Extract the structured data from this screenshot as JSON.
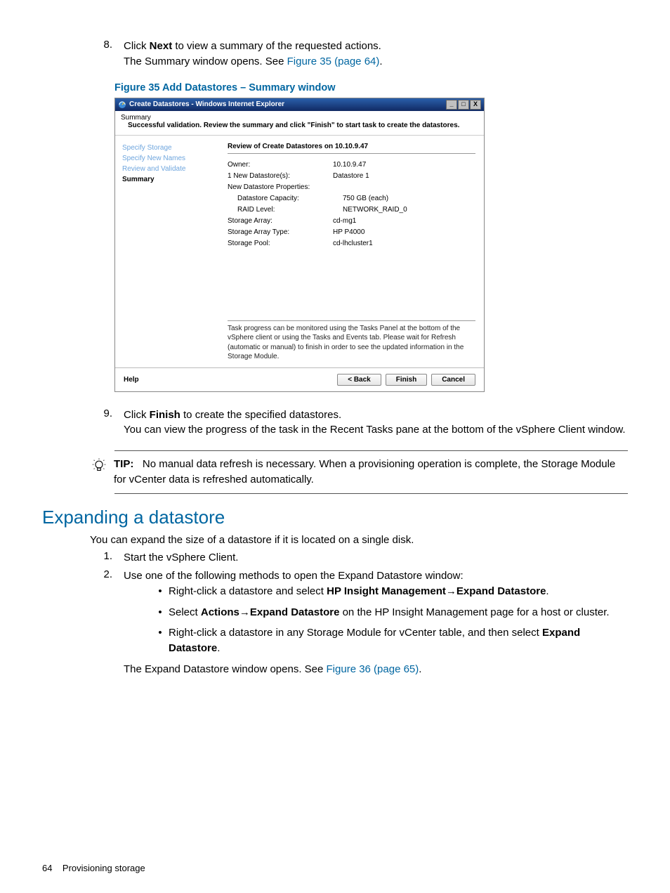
{
  "step8": {
    "num": "8.",
    "line1a": "Click ",
    "line1b": "Next",
    "line1c": " to view a summary of the requested actions.",
    "line2a": "The Summary window opens. See ",
    "line2link": "Figure 35 (page 64)",
    "line2b": "."
  },
  "figcap": "Figure 35 Add Datastores – Summary window",
  "dialog": {
    "title": "Create Datastores - Windows Internet Explorer",
    "wb_min": "_",
    "wb_max": "□",
    "wb_close": "X",
    "head_t1": "Summary",
    "head_t2": "Successful validation. Review the summary and click \"Finish\" to start task to create the datastores.",
    "nav": {
      "n1": "Specify Storage",
      "n2": "Specify New Names",
      "n3": "Review and Validate",
      "n4": "Summary"
    },
    "review_hdr": "Review of Create Datastores on 10.10.9.47",
    "rows": [
      {
        "k": "Owner:",
        "v": "10.10.9.47"
      },
      {
        "k": "1 New Datastore(s):",
        "v": "Datastore 1"
      },
      {
        "k": "New Datastore Properties:",
        "v": ""
      },
      {
        "k": "Datastore Capacity:",
        "v": "750 GB (each)",
        "ind": true
      },
      {
        "k": "RAID Level:",
        "v": "NETWORK_RAID_0",
        "ind": true
      },
      {
        "k": "Storage Array:",
        "v": "cd-mg1"
      },
      {
        "k": "Storage Array Type:",
        "v": "HP P4000"
      },
      {
        "k": "Storage Pool:",
        "v": "cd-lhcluster1"
      }
    ],
    "footnote": "Task progress can be monitored using the Tasks Panel at the bottom of the vSphere client or using the Tasks and Events tab. Please wait for Refresh (automatic or manual) to finish in order to see the updated information in the Storage Module.",
    "help": "Help",
    "back": "< Back",
    "finish": "Finish",
    "cancel": "Cancel"
  },
  "step9": {
    "num": "9.",
    "line1a": "Click ",
    "line1b": "Finish",
    "line1c": " to create the specified datastores.",
    "line2": "You can view the progress of the task in the Recent Tasks pane at the bottom of the vSphere Client window."
  },
  "tip": {
    "label": "TIP:",
    "body": "No manual data refresh is necessary. When a provisioning operation is complete, the Storage Module for vCenter data is refreshed automatically."
  },
  "section_h2": "Expanding a datastore",
  "intro": "You can expand the size of a datastore if it is located on a single disk.",
  "steps2": {
    "s1": {
      "num": "1.",
      "t": "Start the vSphere Client."
    },
    "s2": {
      "num": "2.",
      "t": "Use one of the following methods to open the Expand Datastore window:"
    }
  },
  "bullets": {
    "b1a": "Right-click a datastore and select ",
    "b1b": "HP Insight Management",
    "b1arrow": "→",
    "b1c": "Expand Datastore",
    "b1d": ".",
    "b2a": "Select ",
    "b2b": "Actions",
    "b2arrow": "→",
    "b2c": "Expand Datastore",
    "b2d": " on the HP Insight Management page for a host or cluster.",
    "b3a": "Right-click a datastore in any Storage Module for vCenter table, and then select ",
    "b3b": "Expand Datastore",
    "b3c": "."
  },
  "closing_a": "The Expand Datastore window opens. See ",
  "closing_link": "Figure 36 (page 65)",
  "closing_b": ".",
  "footer_page": "64",
  "footer_title": "Provisioning storage"
}
